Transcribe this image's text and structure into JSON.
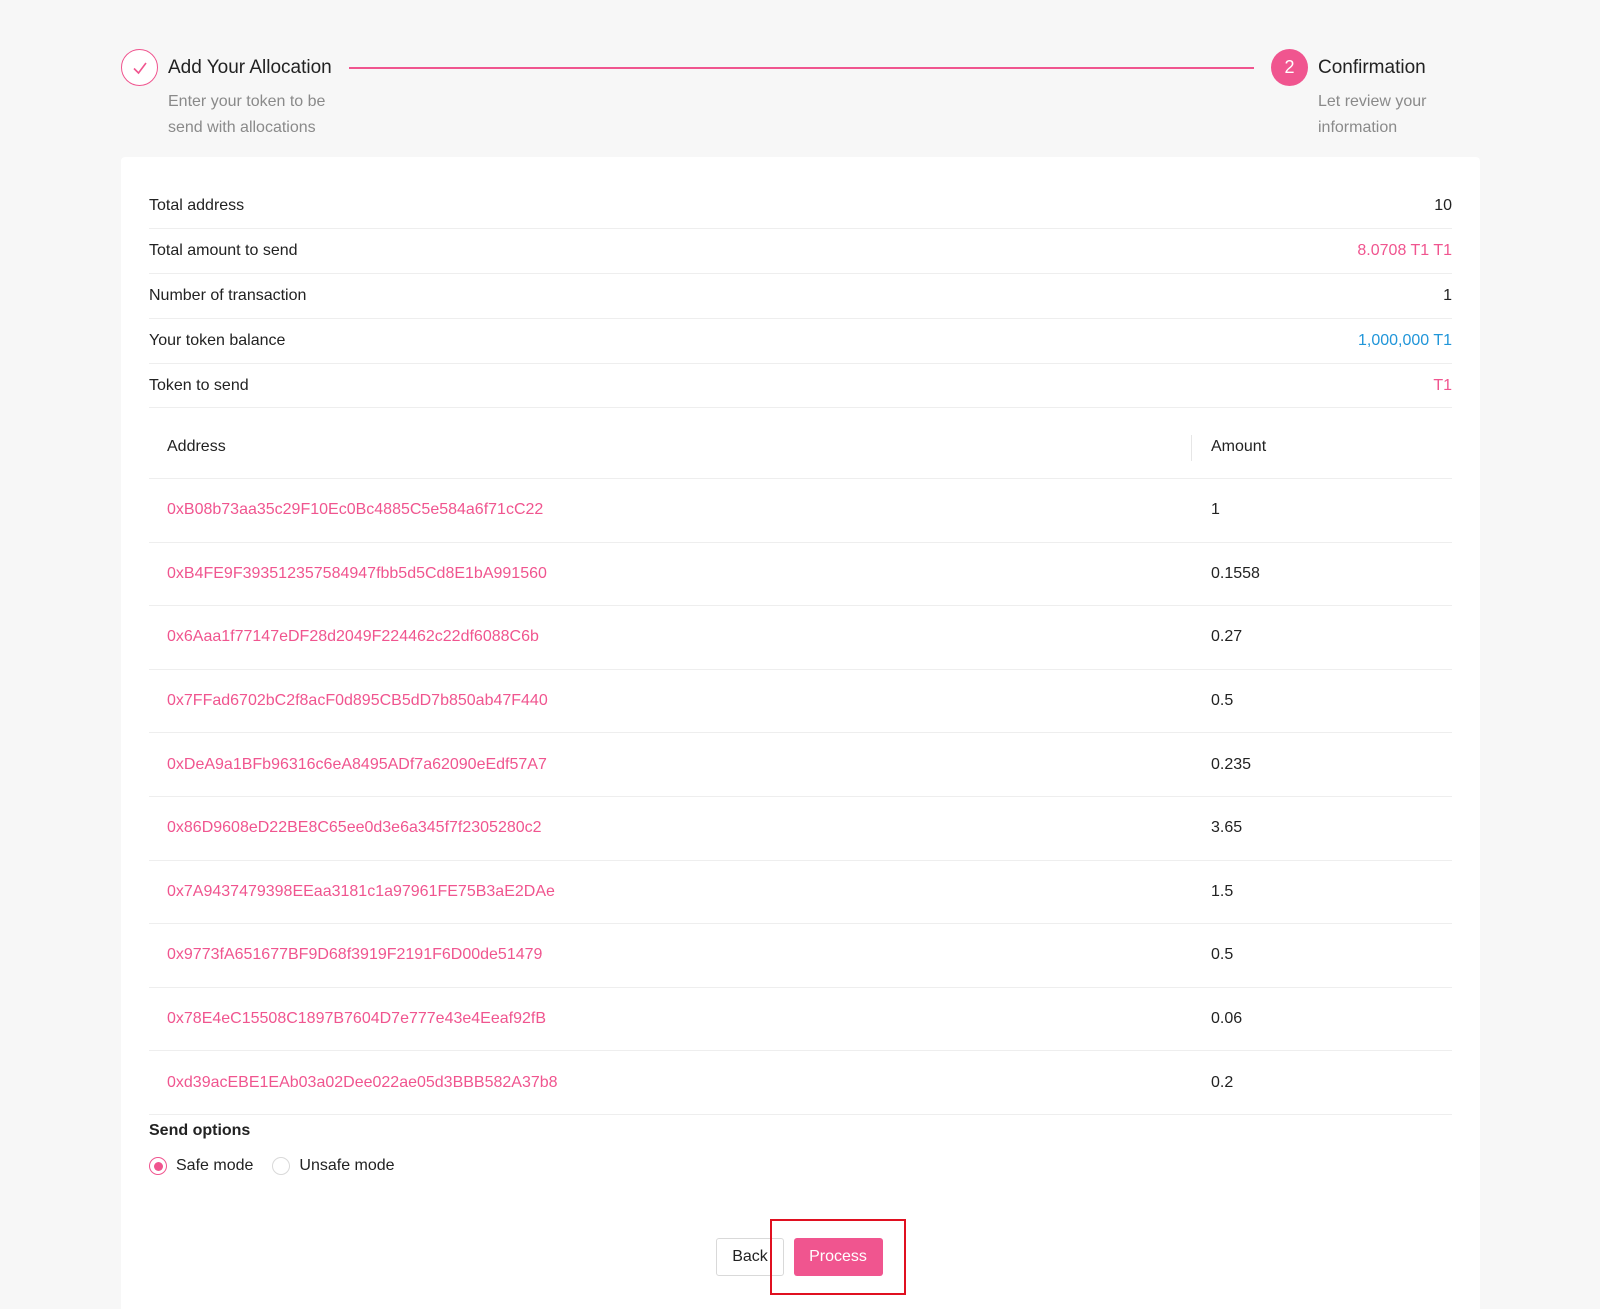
{
  "steps": [
    {
      "title": "Add Your Allocation",
      "desc": "Enter your token to be send with allocations",
      "icon": "check-icon"
    },
    {
      "title": "Confirmation",
      "desc": "Let review your information",
      "number": "2"
    }
  ],
  "summary": [
    {
      "label": "Total address",
      "value": "10",
      "tone": "default"
    },
    {
      "label": "Total amount to send",
      "value": "8.0708 T1 T1",
      "tone": "pink"
    },
    {
      "label": "Number of transaction",
      "value": "1",
      "tone": "default"
    },
    {
      "label": "Your token balance",
      "value": "1,000,000 T1",
      "tone": "blue"
    },
    {
      "label": "Token to send",
      "value": "T1",
      "tone": "pink"
    }
  ],
  "table": {
    "columns": [
      "Address",
      "Amount"
    ],
    "rows": [
      {
        "address": "0xB08b73aa35c29F10Ec0Bc4885C5e584a6f71cC22",
        "amount": "1"
      },
      {
        "address": "0xB4FE9F393512357584947fbb5d5Cd8E1bA991560",
        "amount": "0.1558"
      },
      {
        "address": "0x6Aaa1f77147eDF28d2049F224462c22df6088C6b",
        "amount": "0.27"
      },
      {
        "address": "0x7FFad6702bC2f8acF0d895CB5dD7b850ab47F440",
        "amount": "0.5"
      },
      {
        "address": "0xDeA9a1BFb96316c6eA8495ADf7a62090eEdf57A7",
        "amount": "0.235"
      },
      {
        "address": "0x86D9608eD22BE8C65ee0d3e6a345f7f2305280c2",
        "amount": "3.65"
      },
      {
        "address": "0x7A9437479398EEaa3181c1a97961FE75B3aE2DAe",
        "amount": "1.5"
      },
      {
        "address": "0x9773fA651677BF9D68f3919F2191F6D00de51479",
        "amount": "0.5"
      },
      {
        "address": "0x78E4eC15508C1897B7604D7e777e43e4Eeaf92fB",
        "amount": "0.06"
      },
      {
        "address": "0xd39acEBE1EAb03a02Dee022ae05d3BBB582A37b8",
        "amount": "0.2"
      }
    ]
  },
  "send_options": {
    "title": "Send options",
    "options": [
      "Safe mode",
      "Unsafe mode"
    ],
    "selected": "Safe mode"
  },
  "actions": {
    "back_label": "Back",
    "process_label": "Process"
  },
  "colors": {
    "accent": "#f0558f",
    "blue": "#2196d9",
    "highlight": "#e01020"
  }
}
